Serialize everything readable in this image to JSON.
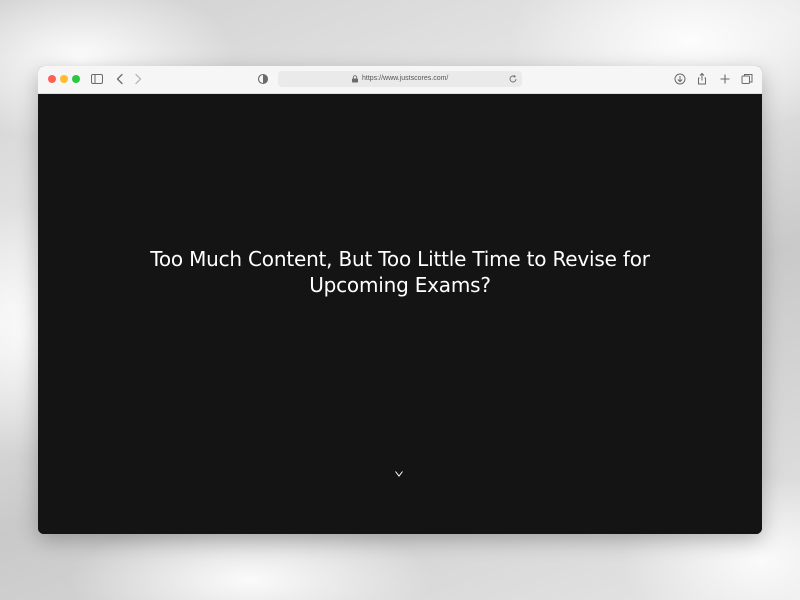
{
  "browser": {
    "url": "https://www.justscores.com/",
    "traffic_lights": {
      "close": "#ff5f57",
      "minimize": "#febc2e",
      "zoom": "#28c840"
    },
    "icons": {
      "sidebar": "sidebar-icon",
      "back": "chevron-left-icon",
      "forward": "chevron-right-icon",
      "privacy": "privacy-shield-icon",
      "lock": "lock-icon",
      "reload": "reload-icon",
      "download": "download-icon",
      "share": "share-icon",
      "new_tab": "plus-icon",
      "tabs": "tab-overview-icon"
    }
  },
  "page": {
    "background": "#141414",
    "headline": "Too Much Content, But Too Little Time to Revise for Upcoming Exams?",
    "scroll_indicator": "arrow-down-icon"
  }
}
